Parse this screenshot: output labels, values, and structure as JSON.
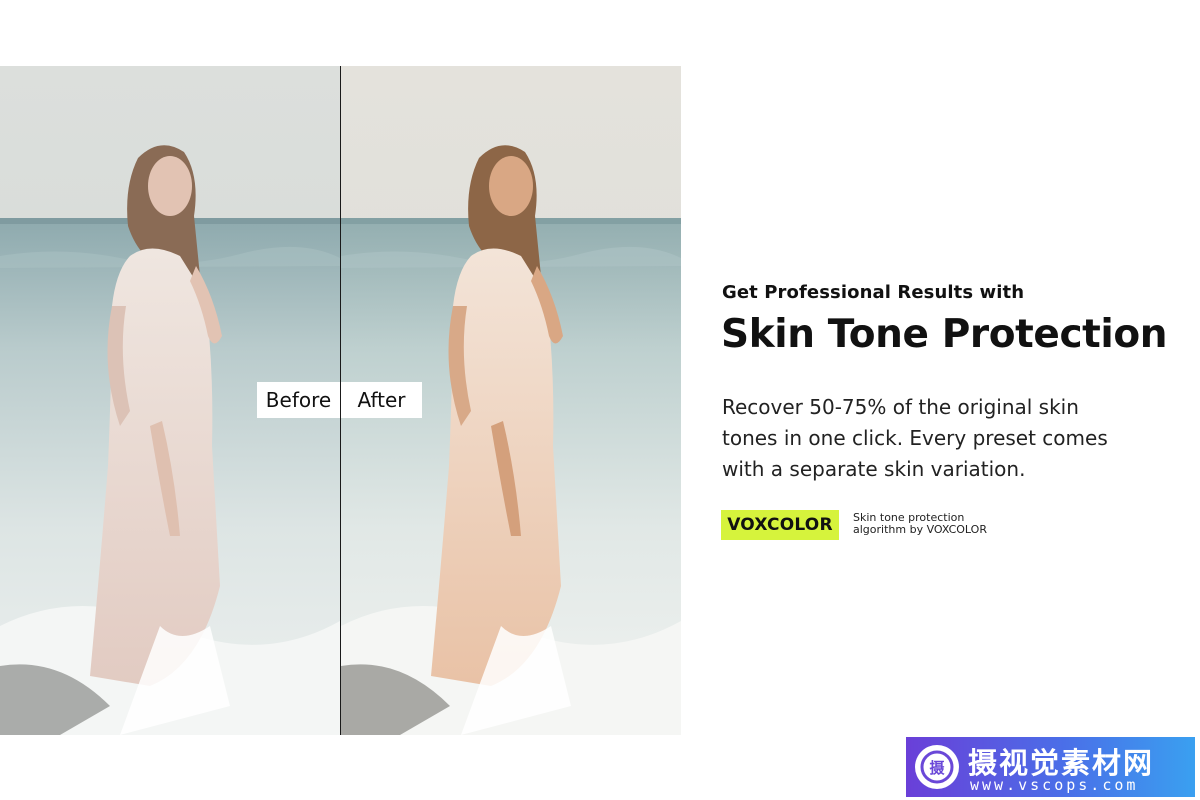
{
  "comparison": {
    "before_label": "Before",
    "after_label": "After"
  },
  "content": {
    "kicker": "Get Professional Results with",
    "headline": "Skin Tone Protection",
    "body": "Recover 50-75% of the original skin\ntones in one click.  Every preset comes\nwith a separate skin variation."
  },
  "brand": {
    "badge_label": "VOXCOLOR",
    "note": "Skin tone protection\nalgorithm by VOXCOLOR",
    "accent_color": "#d6f33c"
  },
  "watermark": {
    "logo_char": "摄",
    "title": "摄视觉素材网",
    "url": "www.vscops.com"
  }
}
